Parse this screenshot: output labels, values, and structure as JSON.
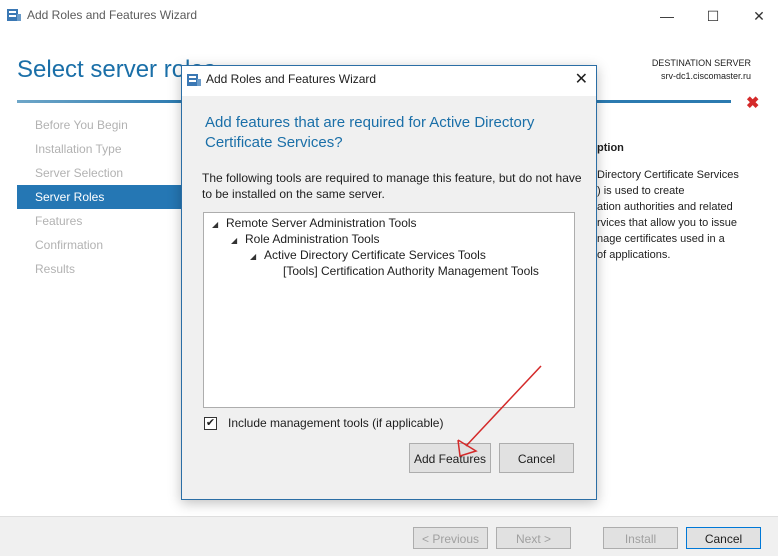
{
  "window": {
    "title": "Add Roles and Features Wizard",
    "page_title": "Select server roles",
    "destination_label": "DESTINATION SERVER",
    "destination_server": "srv-dc1.ciscomaster.ru"
  },
  "steps": [
    {
      "label": "Before You Begin",
      "active": false
    },
    {
      "label": "Installation Type",
      "active": false
    },
    {
      "label": "Server Selection",
      "active": false
    },
    {
      "label": "Server Roles",
      "active": true
    },
    {
      "label": "Features",
      "active": false
    },
    {
      "label": "Confirmation",
      "active": false
    },
    {
      "label": "Results",
      "active": false
    }
  ],
  "description": {
    "heading": "ption",
    "lines": [
      "Directory Certificate Services",
      ") is used to create",
      "ation authorities and related",
      "rvices that allow you to issue",
      "nage certificates used in a",
      "of applications."
    ]
  },
  "footer": {
    "previous": "< Previous",
    "next": "Next >",
    "install": "Install",
    "cancel": "Cancel"
  },
  "modal": {
    "title": "Add Roles and Features Wizard",
    "heading": "Add features that are required for Active Directory Certificate Services?",
    "text": "The following tools are required to manage this feature, but do not have to be installed on the same server.",
    "tree": [
      {
        "label": "Remote Server Administration Tools",
        "level": 0,
        "expanded": true
      },
      {
        "label": "Role Administration Tools",
        "level": 1,
        "expanded": true
      },
      {
        "label": "Active Directory Certificate Services Tools",
        "level": 2,
        "expanded": true
      },
      {
        "label": "[Tools] Certification Authority Management Tools",
        "level": 3,
        "expanded": false
      }
    ],
    "include_label": "Include management tools (if applicable)",
    "include_checked": true,
    "add_button": "Add Features",
    "cancel_button": "Cancel"
  },
  "colors": {
    "accent": "#2577b4",
    "title_blue": "#1a6fa8",
    "error": "#d42a2a",
    "annotation_arrow": "#d42a2a"
  }
}
